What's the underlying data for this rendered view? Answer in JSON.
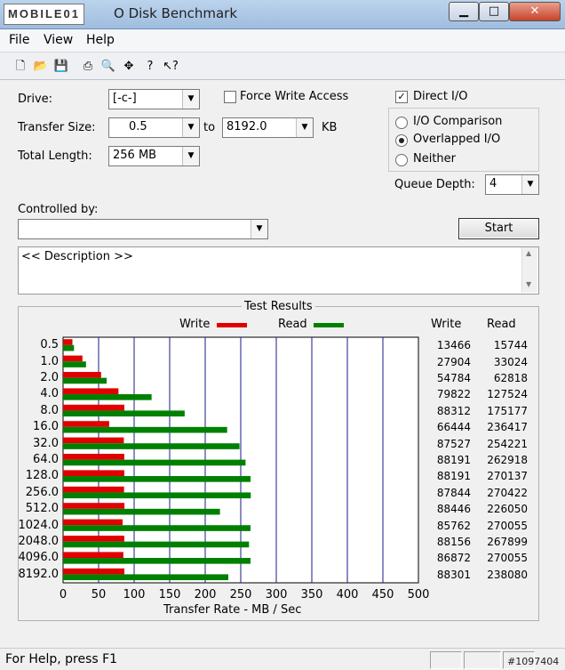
{
  "window": {
    "logo_text": "MOBILE01",
    "title": "Untitled - I/O Disk Benchmark",
    "title_visible": "O Disk Benchmark",
    "min": "▁",
    "max": "□",
    "close": "✕"
  },
  "menu": [
    "File",
    "View",
    "Help"
  ],
  "toolbar": [
    "new-icon",
    "open-icon",
    "save-icon",
    "print-icon",
    "print-preview-icon",
    "move-icon",
    "help-icon",
    "context-help-icon"
  ],
  "form": {
    "drive_label": "Drive:",
    "drive_value": "[-c-]",
    "force_write_label": "Force Write Access",
    "force_write_checked": false,
    "direct_io_label": "Direct I/O",
    "direct_io_checked": true,
    "transfer_size_label": "Transfer Size:",
    "transfer_from": "0.5",
    "to_label": "to",
    "transfer_to": "8192.0",
    "kb_label": "KB",
    "total_length_label": "Total Length:",
    "total_length_value": "256 MB",
    "mode_options": [
      "I/O Comparison",
      "Overlapped I/O",
      "Neither"
    ],
    "mode_selected": 1,
    "queue_depth_label": "Queue Depth:",
    "queue_depth_value": "4",
    "controlled_by_label": "Controlled by:",
    "controlled_by_value": "",
    "start_label": "Start",
    "description": "<< Description >>"
  },
  "results": {
    "title": "Test Results",
    "legend_write": "Write",
    "legend_read": "Read",
    "col_write": "Write",
    "col_read": "Read",
    "xlabel": "Transfer Rate - MB / Sec"
  },
  "chart_data": {
    "type": "bar",
    "orientation": "horizontal",
    "title": "Test Results",
    "xlabel": "Transfer Rate - MB / Sec",
    "xlim": [
      0,
      500
    ],
    "xticks": [
      0,
      50,
      100,
      150,
      200,
      250,
      300,
      350,
      400,
      450,
      500
    ],
    "categories": [
      "0.5",
      "1.0",
      "2.0",
      "4.0",
      "8.0",
      "16.0",
      "32.0",
      "64.0",
      "128.0",
      "256.0",
      "512.0",
      "1024.0",
      "2048.0",
      "4096.0",
      "8192.0"
    ],
    "series": [
      {
        "name": "Write",
        "color": "#e00000",
        "values_kb": [
          13466,
          27904,
          54784,
          79822,
          88312,
          66444,
          87527,
          88191,
          88191,
          87844,
          88446,
          85762,
          88156,
          86872,
          88301
        ]
      },
      {
        "name": "Read",
        "color": "#008000",
        "values_kb": [
          15744,
          33024,
          62818,
          127524,
          175177,
          236417,
          254221,
          262918,
          270137,
          270422,
          226050,
          270055,
          267899,
          270055,
          238080
        ]
      }
    ]
  },
  "status": {
    "text": "For Help, press F1",
    "watermark": "#1097404"
  }
}
